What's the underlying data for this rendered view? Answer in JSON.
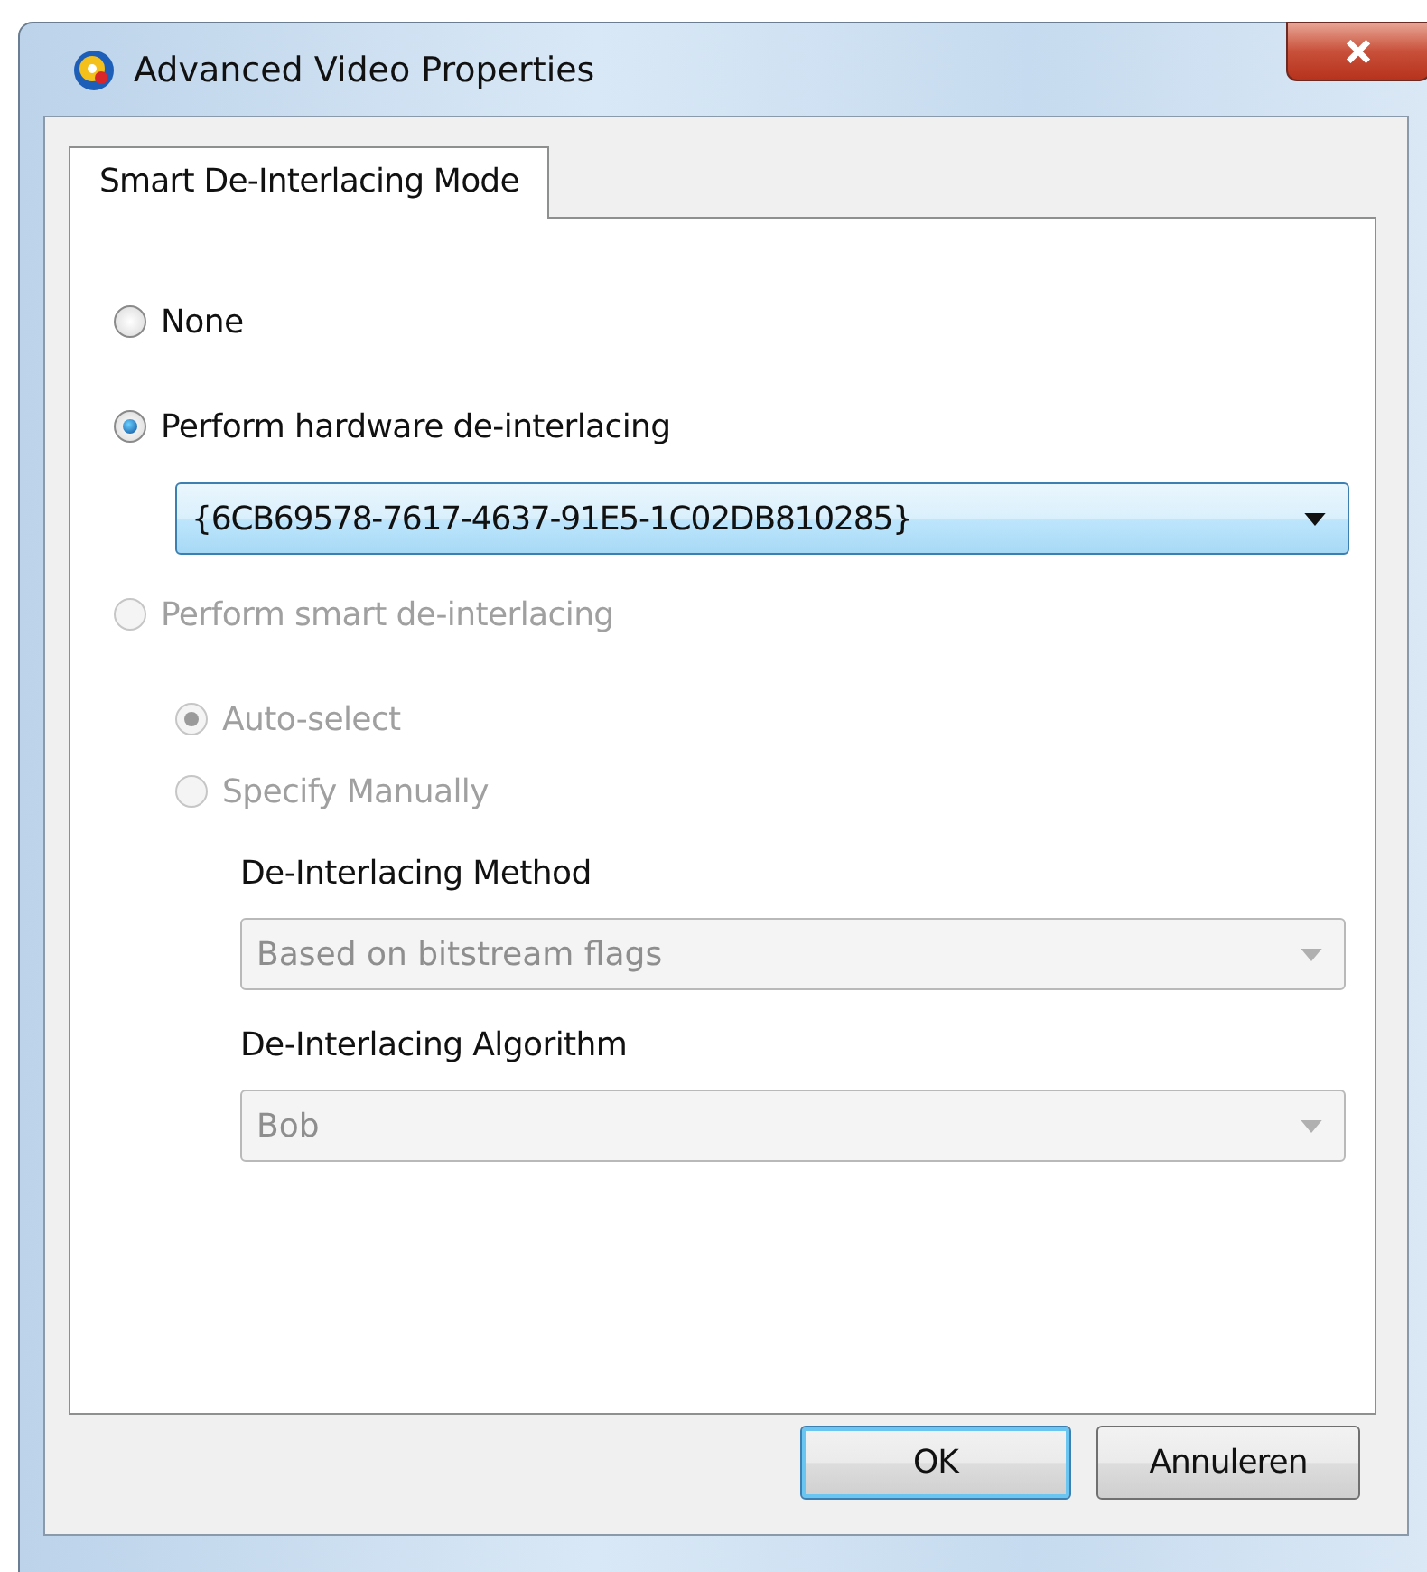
{
  "window": {
    "title": "Advanced Video Properties"
  },
  "tabs": [
    {
      "label": "Smart De-Interlacing Mode",
      "selected": true
    }
  ],
  "modes": [
    {
      "label": "None",
      "selected": false,
      "disabled": false
    },
    {
      "label": "Perform hardware de-interlacing",
      "selected": true,
      "disabled": false
    },
    {
      "label": "Perform smart de-interlacing",
      "selected": false,
      "disabled": true
    }
  ],
  "hardware_device": {
    "value": "{6CB69578-7617-4637-91E5-1C02DB810285}",
    "disabled": false
  },
  "smart_options": [
    {
      "label": "Auto-select",
      "selected": true,
      "disabled": true
    },
    {
      "label": "Specify Manually",
      "selected": false,
      "disabled": true
    }
  ],
  "method": {
    "label": "De-Interlacing Method",
    "value": "Based on bitstream flags",
    "disabled": true
  },
  "algorithm": {
    "label": "De-Interlacing Algorithm",
    "value": "Bob",
    "disabled": true
  },
  "buttons": [
    {
      "label": "OK",
      "default": true
    },
    {
      "label": "Annuleren",
      "default": false
    }
  ]
}
